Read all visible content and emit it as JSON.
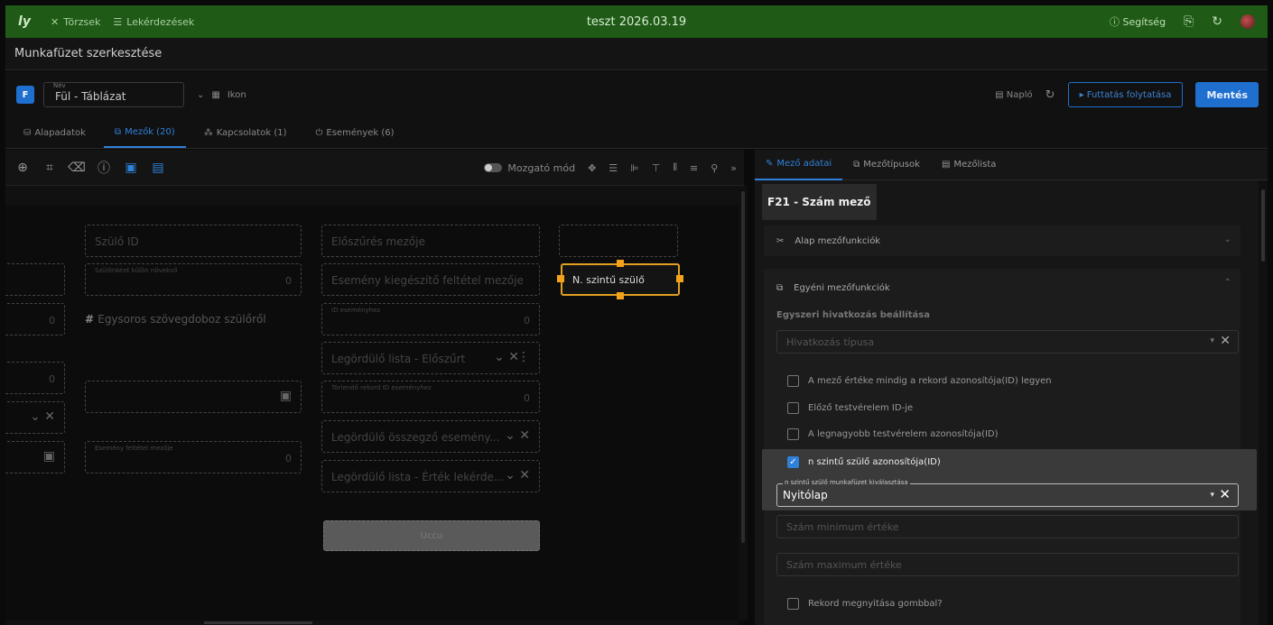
{
  "topbar": {
    "logo": "ly",
    "nav": [
      {
        "icon": "tools-icon",
        "label": "Törzsek"
      },
      {
        "icon": "list-icon",
        "label": "Lekérdezések"
      }
    ],
    "title": "teszt 2026.03.19",
    "help_label": "Segítség",
    "colors": {
      "background": "#1f5a17"
    }
  },
  "titlebar": {
    "title": "Munkafüzet szerkesztése"
  },
  "form": {
    "badge": "F",
    "name_label": "Név",
    "name_value": "Fül - Táblázat",
    "icon_label": "Ikon",
    "log_label": "Napló",
    "run_label": "▸ Futtatás folytatása",
    "save_label": "Mentés"
  },
  "tabs": [
    {
      "label": "Alapadatok",
      "active": false
    },
    {
      "label": "Mezők (20)",
      "active": true
    },
    {
      "label": "Kapcsolatok (1)",
      "active": false
    },
    {
      "label": "Események (6)",
      "active": false
    }
  ],
  "canvas_toolbar": {
    "move_mode_label": "Mozgató mód"
  },
  "canvas_fields": {
    "szulo_id": "Szülő ID",
    "elo_szures": "Előszűrés mezője",
    "szulonkent": "Szülőnként külön növekvő",
    "szulonkent_val": "0",
    "esemeny_kieg": "Esemény kiegészítő feltétel mezője",
    "left_val_1": "0",
    "egysoros": "Egysoros szövegdoboz szülőről",
    "id_esemeny": "ID eseményhez",
    "id_esemeny_val": "0",
    "legordulo_eloszurt": "Legördülő lista - Előszűrt",
    "left_val_2": "0",
    "torlendo": "Törlendő rekord ID eseményhez",
    "torlendo_val": "0",
    "legordulo_osszegzo": "Legördülő összegző esemény...",
    "esemeny_feltetel": "Esemény feltétel mezője",
    "esemeny_feltetel_val": "0",
    "legordulo_ertek": "Legördülő lista - Érték lekérde...",
    "selected_field": "N. szintű szülő",
    "uccu": "Uccu"
  },
  "right_panel": {
    "tabs": [
      {
        "label": "Mező adatai",
        "active": true
      },
      {
        "label": "Mezőtípusok",
        "active": false
      },
      {
        "label": "Mezőlista",
        "active": false
      }
    ],
    "field_title": "F21 - Szám mező",
    "basic_section": "Alap mezőfunkciók",
    "custom_section": "Egyéni mezőfunkciók",
    "subheading": "Egyszeri hivatkozás beállítása",
    "reference_type_placeholder": "Hivatkozás típusa",
    "checkboxes": [
      {
        "label": "A mező értéke mindig a rekord azonosítója(ID) legyen",
        "checked": false
      },
      {
        "label": "Előző testvérelem ID-je",
        "checked": false
      },
      {
        "label": "A legnagyobb testvérelem azonosítója(ID)",
        "checked": false
      },
      {
        "label": "n szintű szülő azonosítója(ID)",
        "checked": true
      }
    ],
    "parent_select_label": "n szintű szülő munkafüzet kiválasztása",
    "parent_select_value": "Nyitólap",
    "min_placeholder": "Szám minimum értéke",
    "max_placeholder": "Szám maximum értéke",
    "open_with_button_label": "Rekord megnyitása gombbal?"
  }
}
